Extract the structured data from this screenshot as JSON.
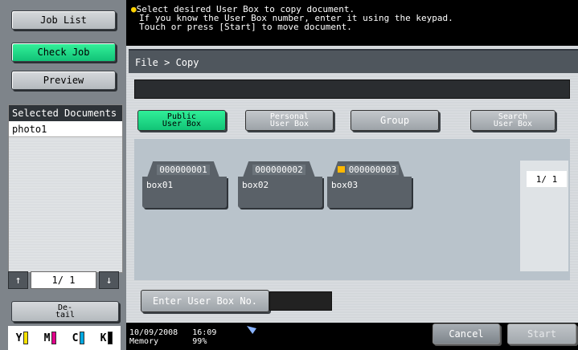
{
  "left": {
    "job_list": "Job List",
    "check_job": "Check Job",
    "preview": "Preview",
    "selected_header": "Selected Documents",
    "selected_items": [
      "photo1"
    ],
    "pager": "1/ 1",
    "detail_line1": "De-",
    "detail_line2": "tail",
    "toner": [
      "Y",
      "M",
      "C",
      "K"
    ],
    "toner_colors": [
      "#f5e100",
      "#e0008a",
      "#00a7e0",
      "#000000"
    ]
  },
  "message": {
    "line1": "Select desired User Box to copy document.",
    "line2": "If you know the User Box number, enter it using the keypad.",
    "line3": "Touch or press [Start] to move document."
  },
  "main": {
    "breadcrumb": "File > Copy",
    "tabs": {
      "public_line1": "Public",
      "public_line2": "User Box",
      "personal_line1": "Personal",
      "personal_line2": "User Box",
      "group": "Group",
      "search_line1": "Search",
      "search_line2": "User Box"
    },
    "boxes": [
      {
        "number": "000000001",
        "name": "box01",
        "locked": false
      },
      {
        "number": "000000002",
        "name": "box02",
        "locked": false
      },
      {
        "number": "000000003",
        "name": "box03",
        "locked": true
      }
    ],
    "page_count": "1/ 1",
    "enter_box_no": "Enter User Box No."
  },
  "bottom": {
    "date": "10/09/2008",
    "time": "16:09",
    "memory_label": "Memory",
    "memory_value": "99%",
    "cancel": "Cancel",
    "start": "Start"
  },
  "colors": {
    "accent_green": "#12c477",
    "dark_bar": "#000000",
    "panel_gray": "#5a6168"
  }
}
